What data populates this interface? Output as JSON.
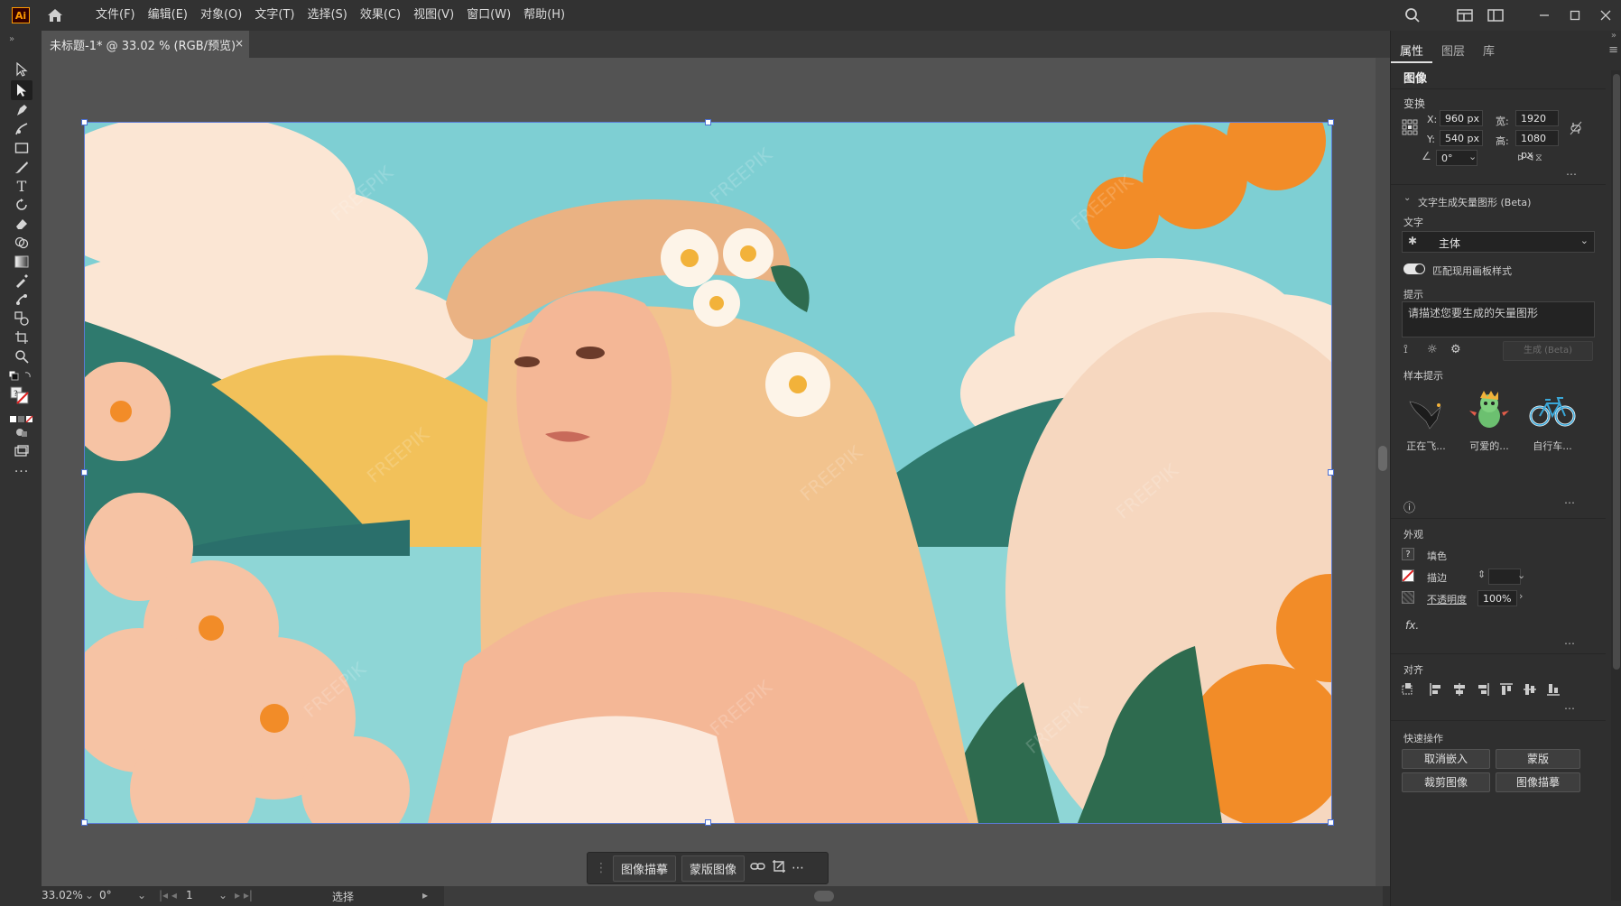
{
  "app": {
    "logo": "Ai",
    "menus": [
      "文件(F)",
      "编辑(E)",
      "对象(O)",
      "文字(T)",
      "选择(S)",
      "效果(C)",
      "视图(V)",
      "窗口(W)",
      "帮助(H)"
    ]
  },
  "document_tab": {
    "title": "未标题-1* @ 33.02 % (RGB/预览)",
    "close": "×"
  },
  "artwork": {
    "watermark": "FREEPIK",
    "colors": {
      "sky": "#7ecfd3",
      "cloud": "#fbe6d4",
      "hill_green": "#2f7a6e",
      "hill_yellow": "#f2c15a",
      "water": "#8ed6d6",
      "skin": "#f4b796",
      "hair": "#f2c38e",
      "hat": "#eab283",
      "flower_orange": "#f28c28",
      "flower_peach": "#f6c3a4"
    }
  },
  "context_bar": {
    "trace_label": "图像描摹",
    "mask_label": "蒙版图像",
    "more": "⋯"
  },
  "status_bar": {
    "zoom": "33.02%",
    "rotation": "0°",
    "artboard_number": "1",
    "tool_name": "选择"
  },
  "panel": {
    "tabs": [
      "属性",
      "图层",
      "库"
    ],
    "object_type": "图像",
    "transform": {
      "heading": "变换",
      "x_label": "X:",
      "x": "960 px",
      "y_label": "Y:",
      "y": "540 px",
      "w_label": "宽:",
      "w": "1920 px",
      "h_label": "高:",
      "h": "1080 px",
      "angle": "0°"
    },
    "text_to_vector": {
      "heading": "文字生成矢量图形 (Beta)",
      "type_label": "文字",
      "type_value": "主体",
      "match_label": "匹配现用画板样式",
      "prompt_label": "提示",
      "prompt_placeholder": "请描述您要生成的矢量图形",
      "generate_label": "生成 (Beta)",
      "samples_label": "样本提示",
      "samples": [
        "正在飞...",
        "可爱的...",
        "自行车..."
      ]
    },
    "appearance": {
      "heading": "外观",
      "fill_label": "填色",
      "stroke_label": "描边",
      "opacity_label": "不透明度",
      "opacity_value": "100%",
      "fx": "fx."
    },
    "align": {
      "heading": "对齐"
    },
    "quick_actions": {
      "heading": "快速操作",
      "unembed": "取消嵌入",
      "mask": "蒙版",
      "crop": "裁剪图像",
      "trace": "图像描摹"
    }
  }
}
